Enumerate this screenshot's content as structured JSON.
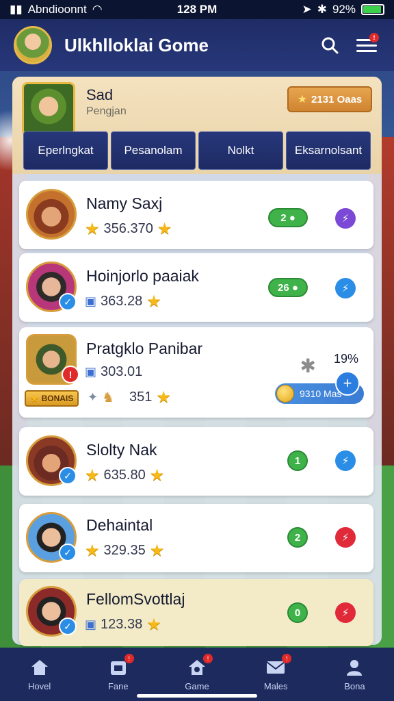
{
  "status_bar": {
    "carrier": "Abndioonnt",
    "time": "128 PM",
    "battery": "92%"
  },
  "header": {
    "title": "Ulkhlloklai Gome"
  },
  "profile": {
    "name": "Sad",
    "subtitle": "Pengjan",
    "coins": "2131 Oaas"
  },
  "tabs": [
    "Eperlngkat",
    "Pesanolam",
    "Nolkt",
    "Eksarnolsant"
  ],
  "rows": [
    {
      "name": "Namy Saxj",
      "score": "356.370",
      "status": "2",
      "action_color": "#7b49d6",
      "highlight": false
    },
    {
      "name": "Hoinjorlo paaiak",
      "score": "363.28",
      "status": "26",
      "action_color": "#2a8de6",
      "highlight": false
    },
    {
      "name": "Pratgklo Panibar",
      "score": "303.01",
      "score2": "351",
      "bonus": "BONAIS",
      "percent": "19%",
      "coin_bar": "9310 Mas",
      "highlight": false
    },
    {
      "name": "Slolty Nak",
      "score": "635.80",
      "status": "1",
      "action_color": "#2a8de6",
      "highlight": false
    },
    {
      "name": "Dehaintal",
      "score": "329.35",
      "status": "2",
      "action_color": "#e02a3a",
      "highlight": false
    },
    {
      "name": "FellomSvottlaj",
      "score": "123.38",
      "status": "0",
      "action_color": "#e02a3a",
      "highlight": true
    }
  ],
  "nav": [
    {
      "label": "Hovel",
      "icon": "home-icon"
    },
    {
      "label": "Fane",
      "icon": "inbox-icon"
    },
    {
      "label": "Game",
      "icon": "game-house-icon"
    },
    {
      "label": "Males",
      "icon": "mail-icon"
    },
    {
      "label": "Bona",
      "icon": "profile-icon"
    }
  ]
}
